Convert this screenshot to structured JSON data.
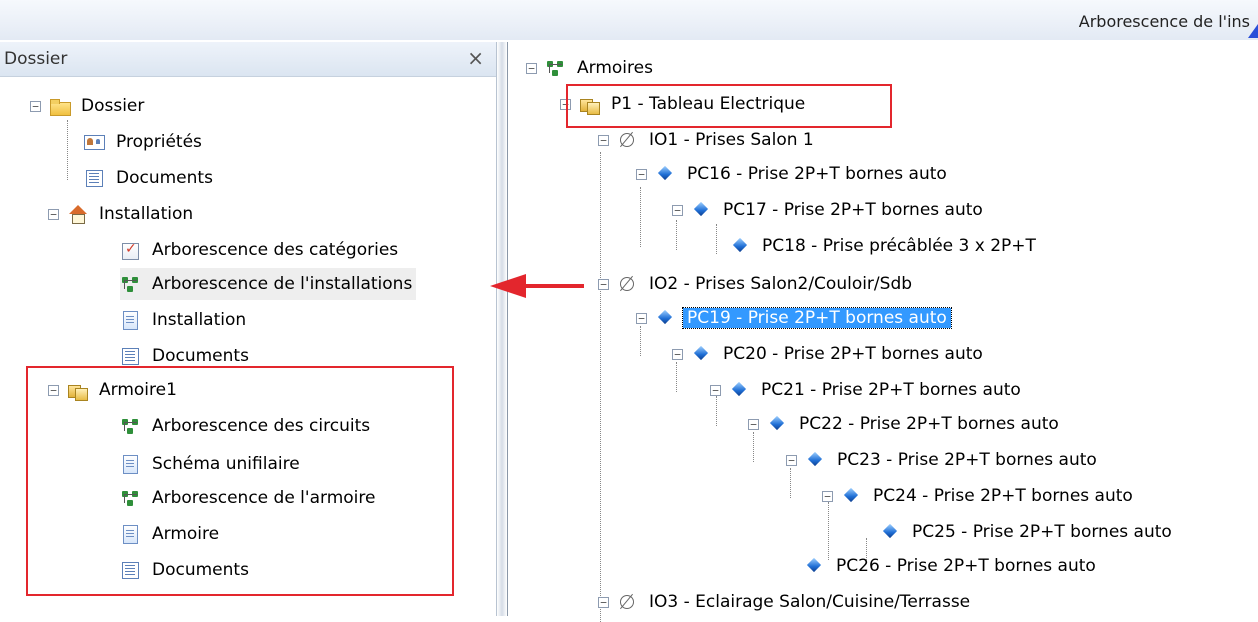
{
  "window": {
    "title": "Arborescence de l'ins"
  },
  "left_panel": {
    "title": "Dossier",
    "close_glyph": "×",
    "tree": [
      {
        "label": "Dossier",
        "expander": "−"
      },
      {
        "label": "Propriétés"
      },
      {
        "label": "Documents"
      },
      {
        "label": "Installation",
        "expander": "−"
      },
      {
        "label": "Arborescence des catégories"
      },
      {
        "label": "Arborescence de l'installations"
      },
      {
        "label": "Installation"
      },
      {
        "label": "Documents"
      },
      {
        "label": "Armoire1",
        "expander": "−"
      },
      {
        "label": "Arborescence des circuits"
      },
      {
        "label": "Schéma unifilaire"
      },
      {
        "label": "Arborescence de l'armoire"
      },
      {
        "label": "Armoire"
      },
      {
        "label": "Documents"
      }
    ]
  },
  "right_panel": {
    "tree": [
      {
        "label": "Armoires",
        "expander": "−"
      },
      {
        "label": "P1 - Tableau Electrique",
        "expander": "−"
      },
      {
        "label": "IO1 - Prises Salon 1",
        "expander": "−"
      },
      {
        "label": "PC16 - Prise 2P+T bornes auto",
        "expander": "−"
      },
      {
        "label": "PC17 - Prise 2P+T bornes auto",
        "expander": "−"
      },
      {
        "label": "PC18 - Prise précâblée 3 x 2P+T"
      },
      {
        "label": "IO2 - Prises Salon2/Couloir/Sdb",
        "expander": "−"
      },
      {
        "label": "PC19 - Prise 2P+T bornes auto",
        "expander": "−",
        "selected": true
      },
      {
        "label": "PC20 - Prise 2P+T bornes auto",
        "expander": "−"
      },
      {
        "label": "PC21 - Prise 2P+T bornes auto",
        "expander": "−"
      },
      {
        "label": "PC22 - Prise 2P+T bornes auto",
        "expander": "−"
      },
      {
        "label": "PC23 - Prise 2P+T bornes auto",
        "expander": "−"
      },
      {
        "label": "PC24 - Prise 2P+T bornes auto",
        "expander": "−"
      },
      {
        "label": "PC25 - Prise 2P+T bornes auto"
      },
      {
        "label": "PC26 - Prise 2P+T bornes auto"
      },
      {
        "label": "IO3 - Eclairage Salon/Cuisine/Terrasse",
        "expander": "−"
      }
    ]
  },
  "annotations": {
    "highlight_color": "#e3262d",
    "selection_color": "#3399ff"
  }
}
